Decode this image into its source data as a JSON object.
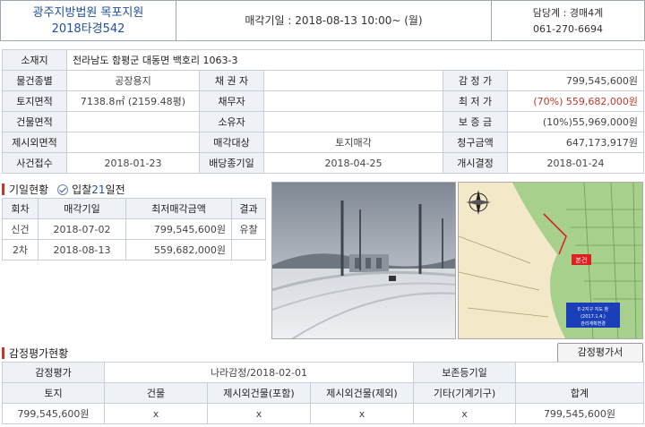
{
  "header": {
    "court": "광주지방법원 목포지원",
    "case_no": "2018타경542",
    "sale_date": "매각기일 : 2018-08-13   10:00~ (월)",
    "dept": "담당계 : 경매4계",
    "phone": "061-270-6694"
  },
  "info": {
    "address_label": "소재지",
    "address": "전라남도 함평군 대동면 백호리 1063-3",
    "rows": [
      {
        "l1": "물건종별",
        "v1": "공장용지",
        "l2": "채 권 자",
        "v2": "",
        "l3": "감 정 가",
        "v3": "799,545,600원"
      },
      {
        "l1": "토지면적",
        "v1": "7138.8㎡ (2159.48평)",
        "l2": "채무자",
        "v2": "",
        "l3": "최 저 가",
        "v3": "(70%) 559,682,000원"
      },
      {
        "l1": "건물면적",
        "v1": "",
        "l2": "소유자",
        "v2": "",
        "l3": "보 증 금",
        "v3": "(10%)55,969,000원"
      },
      {
        "l1": "제시외면적",
        "v1": "",
        "l2": "매각대상",
        "v2": "토지매각",
        "l3": "청구금액",
        "v3": "647,173,917원"
      },
      {
        "l1": "사건접수",
        "v1": "2018-01-23",
        "l2": "배당종기일",
        "v2": "2018-04-25",
        "l3": "개시결정",
        "v3": "2018-01-24"
      }
    ]
  },
  "history": {
    "title": "기일현황",
    "subtitle_prefix": "입찰",
    "subtitle_days": "21",
    "subtitle_suffix": "일전",
    "headers": [
      "회차",
      "매각기일",
      "최저매각금액",
      "결과"
    ],
    "rows": [
      {
        "round": "신건",
        "date": "2018-07-02",
        "price": "799,545,600원",
        "result": "유찰"
      },
      {
        "round": "2차",
        "date": "2018-08-13",
        "price": "559,682,000원",
        "result": ""
      }
    ]
  },
  "map": {
    "badge": "본건",
    "legend_lines": [
      "E-2지구 지도 참",
      "(2017.1.4.)",
      "관리계획변경"
    ]
  },
  "appraisal": {
    "title": "감정평가현황",
    "button": "감정평가서",
    "label_eval": "감정평가",
    "eval_value": "나라감정/2018-02-01",
    "label_preserve": "보존등기일",
    "preserve_value": "",
    "headers": [
      "토지",
      "건물",
      "제시외건물(포함)",
      "제시외건물(제외)",
      "기타(기계기구)",
      "합계"
    ],
    "values": [
      "799,545,600원",
      "x",
      "x",
      "x",
      "x",
      "799,545,600원"
    ]
  },
  "colors": {
    "accent_red": "#c0392b",
    "court_blue": "#1f4fa0"
  }
}
